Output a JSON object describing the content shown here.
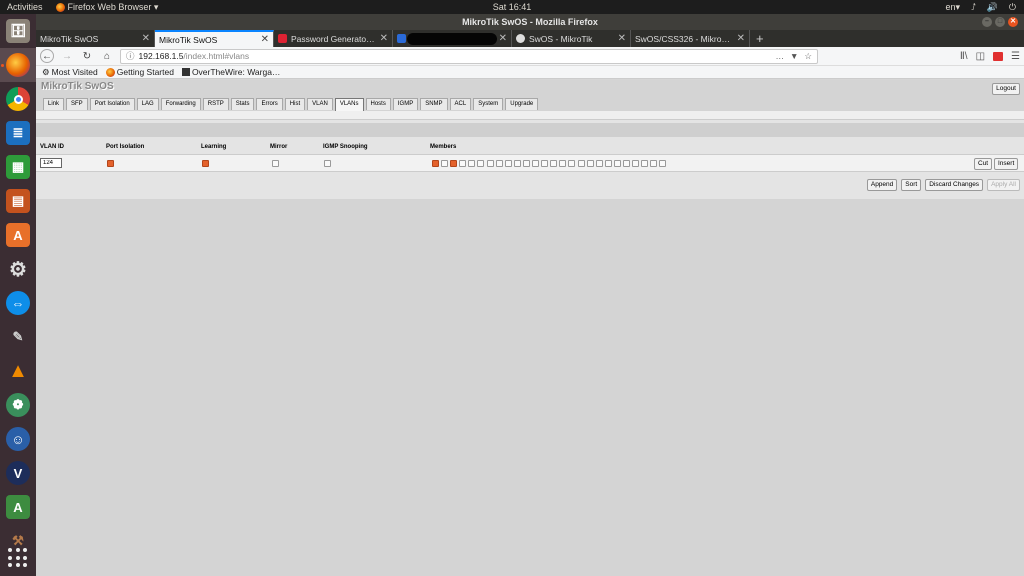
{
  "topbar": {
    "activities": "Activities",
    "app_menu": "Firefox Web Browser ▾",
    "clock": "Sat 16:41",
    "lang": "en▾",
    "tray_icons": [
      "network-icon",
      "volume-icon",
      "power-icon"
    ]
  },
  "window": {
    "title": "MikroTik SwOS - Mozilla Firefox"
  },
  "tabs": [
    {
      "label": "MikroTik SwOS",
      "selected": false
    },
    {
      "label": "MikroTik SwOS",
      "selected": true
    },
    {
      "label": "Password Generator | La",
      "selected": false
    },
    {
      "label": "",
      "selected": false,
      "redacted": true
    },
    {
      "label": "SwOS - MikroTik",
      "selected": false
    },
    {
      "label": "SwOS/CSS326 - MikroTik Wi",
      "selected": false
    }
  ],
  "url": {
    "host": "192.168.1.5",
    "path": "/index.html#vlans"
  },
  "bookmarks": [
    "Most Visited",
    "Getting Started",
    "OverTheWire: Warga…"
  ],
  "swos": {
    "title": "MikroTik SwOS",
    "logout": "Logout",
    "tabs": [
      "Link",
      "SFP",
      "Port Isolation",
      "LAG",
      "Forwarding",
      "RSTP",
      "Stats",
      "Errors",
      "Hist",
      "VLAN",
      "VLANs",
      "Hosts",
      "IGMP",
      "SNMP",
      "ACL",
      "System",
      "Upgrade"
    ],
    "active_tab": "VLANs",
    "columns": [
      "VLAN ID",
      "Port Isolation",
      "Learning",
      "Mirror",
      "IGMP Snooping",
      "Members"
    ],
    "row": {
      "vlan_id": "124",
      "port_isolation": true,
      "learning": true,
      "mirror": false,
      "igmp_snooping": false,
      "members": [
        true,
        false,
        true,
        false,
        false,
        false,
        false,
        false,
        false,
        false,
        false,
        false,
        false,
        false,
        false,
        false,
        false,
        false,
        false,
        false,
        false,
        false,
        false,
        false,
        false,
        false
      ]
    },
    "row_buttons": {
      "cut": "Cut",
      "insert": "Insert"
    },
    "actions": {
      "append": "Append",
      "sort": "Sort",
      "discard": "Discard Changes",
      "apply": "Apply All"
    }
  },
  "colors": {
    "accent": "#e4622c",
    "ubuntu_orange": "#e95420",
    "page_bg": "#d4d4d4"
  }
}
